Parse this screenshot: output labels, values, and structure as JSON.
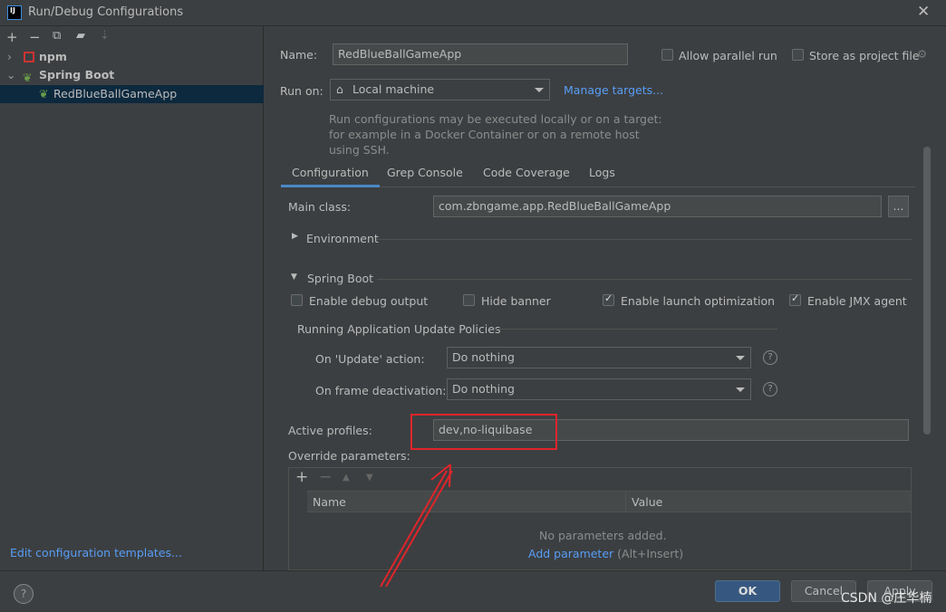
{
  "window": {
    "title": "Run/Debug Configurations",
    "logo": "IJ"
  },
  "toolbar": {
    "icons": [
      "add-icon",
      "remove-icon",
      "copy-icon",
      "folder-add-icon",
      "sort-icon"
    ]
  },
  "tree": [
    {
      "label": "npm",
      "icon": "npm-icon",
      "bold": true
    },
    {
      "label": "Spring Boot",
      "icon": "spring-boot-icon",
      "bold": true
    },
    {
      "label": "RedBlueBallGameApp",
      "icon": "spring-boot-icon",
      "selected": true
    }
  ],
  "edit_templates": "Edit configuration templates...",
  "name_label": "Name:",
  "name_value": "RedBlueBallGameApp",
  "allow_parallel": {
    "label": "Allow parallel run",
    "checked": false
  },
  "store_project": {
    "label": "Store as project file",
    "checked": false
  },
  "run_on_label": "Run on:",
  "run_on_value": "Local machine",
  "manage_targets": "Manage targets...",
  "run_on_hint": "Run configurations may be executed locally or on a target: for example in a Docker Container or on a remote host using SSH.",
  "tabs": [
    "Configuration",
    "Grep Console",
    "Code Coverage",
    "Logs"
  ],
  "main_class_label": "Main class:",
  "main_class_value": "com.zbngame.app.RedBlueBallGameApp",
  "browse": "...",
  "environment": "Environment",
  "spring_boot": "Spring Boot",
  "checkboxes": [
    {
      "label": "Enable debug output",
      "checked": false
    },
    {
      "label": "Hide banner",
      "checked": false
    },
    {
      "label": "Enable launch optimization",
      "checked": true
    },
    {
      "label": "Enable JMX agent",
      "checked": true
    }
  ],
  "update_policies": "Running Application Update Policies",
  "on_update_label": "On 'Update' action:",
  "on_update_value": "Do nothing",
  "on_frame_label": "On frame deactivation:",
  "on_frame_value": "Do nothing",
  "active_profiles_label": "Active profiles:",
  "active_profiles_value": "dev,no-liquibase",
  "override_label": "Override parameters:",
  "table": {
    "columns": [
      "Name",
      "Value"
    ],
    "empty": "No parameters added.",
    "add": "Add parameter",
    "shortcut": "(Alt+Insert)"
  },
  "buttons": {
    "ok": "OK",
    "cancel": "Cancel",
    "apply": "Apply"
  },
  "watermark": "CSDN @庄华楠",
  "colors": {
    "accent": "#4a88c7",
    "link": "#589df6",
    "annotation": "#e0242b",
    "ok": "#365880"
  }
}
